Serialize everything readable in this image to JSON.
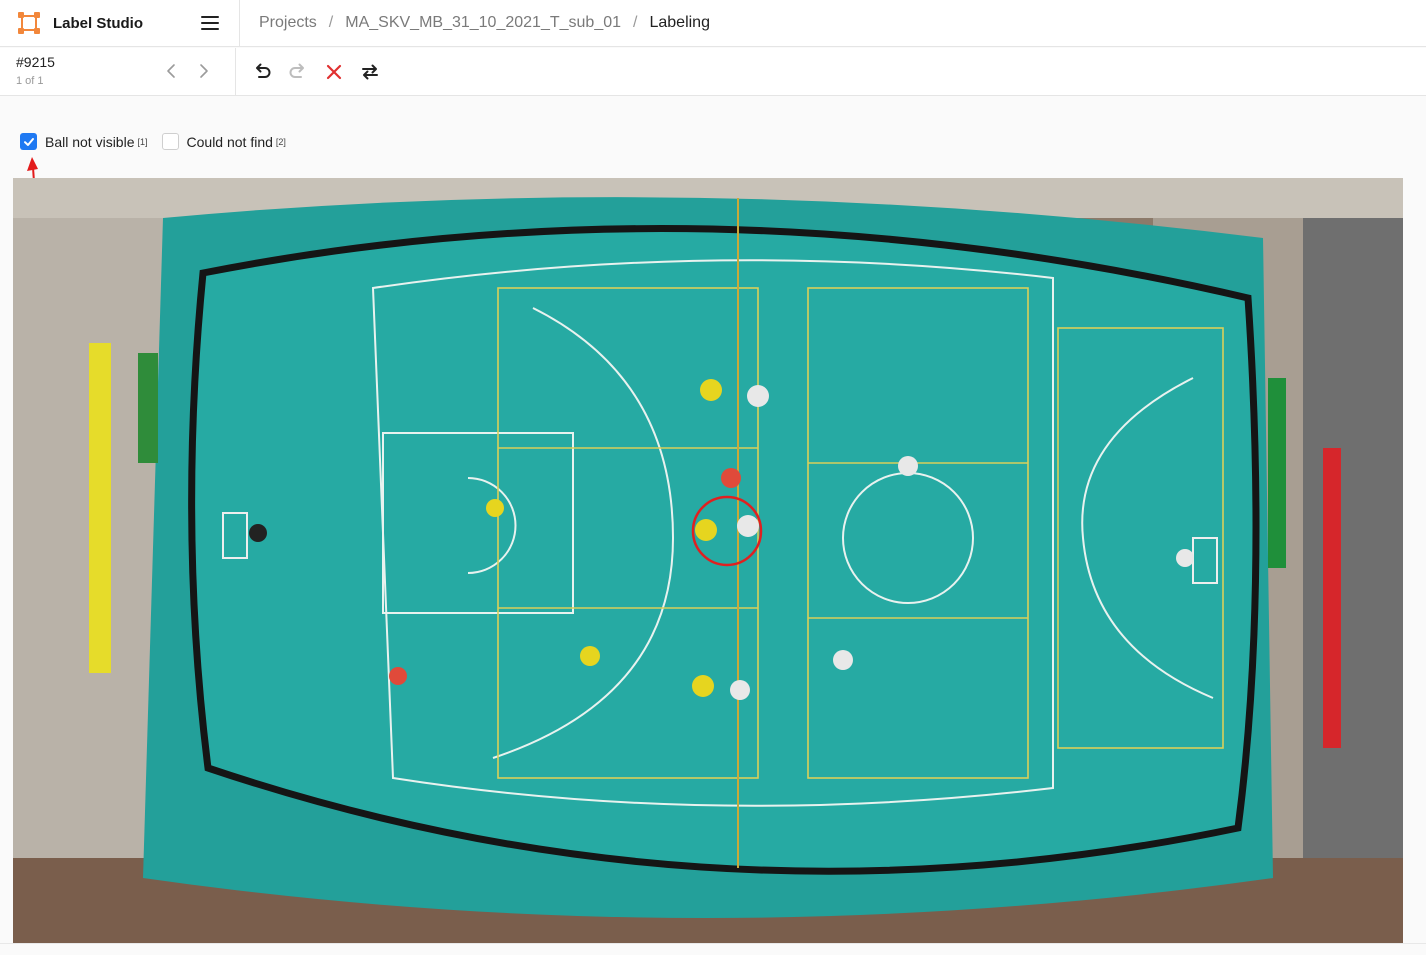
{
  "app": {
    "name": "Label Studio",
    "logo_icon": "label-studio-logo-icon",
    "accent": "#f2873b"
  },
  "breadcrumb": [
    {
      "label": "Projects"
    },
    {
      "label": "MA_SKV_MB_31_10_2021_T_sub_01"
    },
    {
      "label": "Labeling"
    }
  ],
  "breadcrumb_separator": "/",
  "task": {
    "id": "#9215",
    "count": "1 of 1"
  },
  "toolbar": {
    "undo_icon": "undo-icon",
    "redo_icon": "redo-icon",
    "reset_icon": "close-icon",
    "settings_icon": "swap-icon",
    "reset_color": "#e03030"
  },
  "choices": [
    {
      "label": "Ball not visible",
      "hotkey": "[1]",
      "checked": true
    },
    {
      "label": "Could not find",
      "hotkey": "[2]",
      "checked": false
    }
  ],
  "checkbox_color": "#1f79f2",
  "image": {
    "description_icon": "floorball-court-image",
    "ball_marker_color": "#e02020"
  }
}
